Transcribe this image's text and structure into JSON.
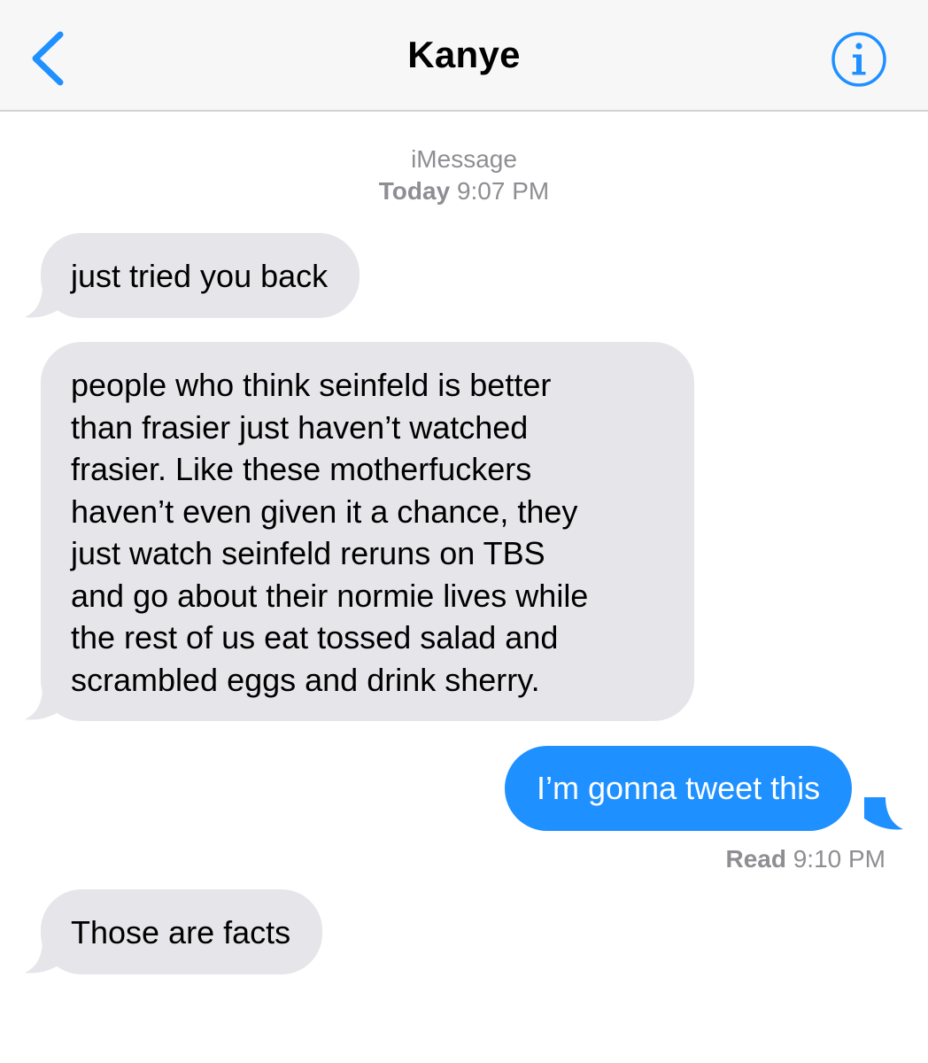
{
  "header": {
    "title": "Kanye",
    "back_icon": "chevron-left-icon",
    "info_icon": "info-circle-icon"
  },
  "thread": {
    "service_label": "iMessage",
    "day_label": "Today",
    "time_label": "9:07 PM"
  },
  "messages": [
    {
      "from": "them",
      "text": "just tried you back"
    },
    {
      "from": "them",
      "text": "people who think seinfeld is better\nthan frasier just haven’t watched\nfrasier. Like these motherfuckers\nhaven’t even given it a chance, they\njust watch seinfeld reruns on TBS\nand go about their normie lives while\nthe rest of us eat tossed salad and\nscrambled eggs and drink sherry."
    },
    {
      "from": "me",
      "text": "I’m gonna tweet this"
    },
    {
      "from": "them",
      "text": "Those are facts"
    }
  ],
  "receipt": {
    "label": "Read",
    "time": "9:10 PM"
  },
  "colors": {
    "accent": "#1e90ff",
    "incoming_bubble": "#e5e5ea",
    "meta_text": "#8e8e93",
    "nav_bg": "#f7f7f7"
  }
}
